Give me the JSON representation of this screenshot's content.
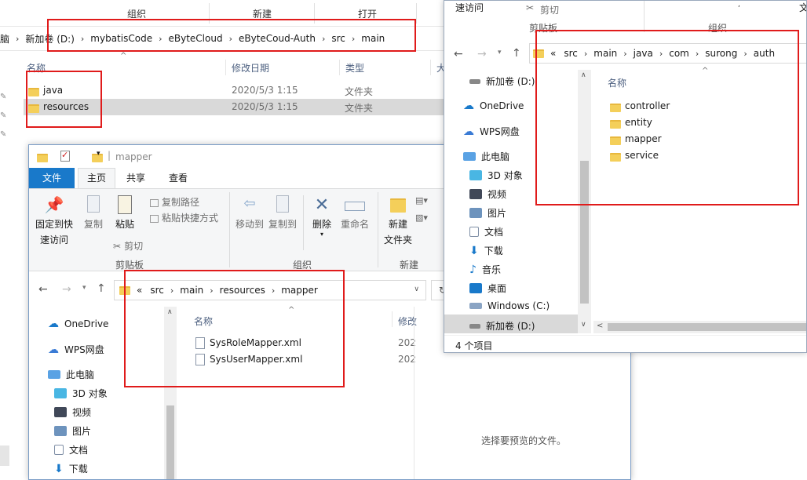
{
  "back_window": {
    "ribbon_groups": [
      "组织",
      "新建",
      "打开"
    ],
    "crumbs": [
      "脑",
      "新加卷 (D:)",
      "mybatisCode",
      "eByteCloud",
      "eByteCoud-Auth",
      "src",
      "main"
    ],
    "col_name": "名称",
    "col_date": "修改日期",
    "col_type": "类型",
    "col_size": "大",
    "rows": [
      {
        "name": "java",
        "date": "2020/5/3 1:15",
        "type": "文件夹"
      },
      {
        "name": "resources",
        "date": "2020/5/3 1:15",
        "type": "文件夹"
      }
    ]
  },
  "middle_window": {
    "title": "mapper",
    "tabs": [
      "文件",
      "主页",
      "共享",
      "查看"
    ],
    "ribbon": {
      "pin": "固定到快\n速访问",
      "pin_line1": "固定到快",
      "pin_line2": "速访问",
      "copy": "复制",
      "paste": "粘贴",
      "copy_path": "复制路径",
      "paste_shortcut": "粘贴快捷方式",
      "cut": "剪切",
      "clipboard": "剪贴板",
      "move_to": "移动到",
      "copy_to": "复制到",
      "delete": "删除",
      "rename": "重命名",
      "organize": "组织",
      "new_folder_line1": "新建",
      "new_folder_line2": "文件夹",
      "new_group": "新建"
    },
    "crumb_prefix": "«",
    "crumbs": [
      "src",
      "main",
      "resources",
      "mapper"
    ],
    "nav": [
      "OneDrive",
      "WPS网盘",
      "此电脑",
      "3D 对象",
      "视频",
      "图片",
      "文档",
      "下载"
    ],
    "col_name": "名称",
    "col_date": "修改",
    "files": [
      {
        "name": "SysRoleMapper.xml",
        "date": "202"
      },
      {
        "name": "SysUserMapper.xml",
        "date": "202"
      }
    ],
    "preview_text": "选择要预览的文件。"
  },
  "right_window": {
    "quick_access": "速访问",
    "cut": "剪切",
    "clipboard": "剪贴板",
    "organize": "组织",
    "top_right": "文",
    "crumb_prefix": "«",
    "crumbs": [
      "src",
      "main",
      "java",
      "com",
      "surong",
      "auth"
    ],
    "nav": [
      "新加卷 (D:)",
      "OneDrive",
      "WPS网盘",
      "此电脑",
      "3D 对象",
      "视频",
      "图片",
      "文档",
      "下载",
      "音乐",
      "桌面",
      "Windows (C:)",
      "新加卷 (D:)"
    ],
    "col_name": "名称",
    "folders": [
      "controller",
      "entity",
      "mapper",
      "service"
    ],
    "status": "4 个项目"
  },
  "colors": {
    "accent": "#1979ca",
    "highlight": "#e01b1b",
    "selected": "#cce8ff",
    "folder": "#f4cf5a"
  }
}
